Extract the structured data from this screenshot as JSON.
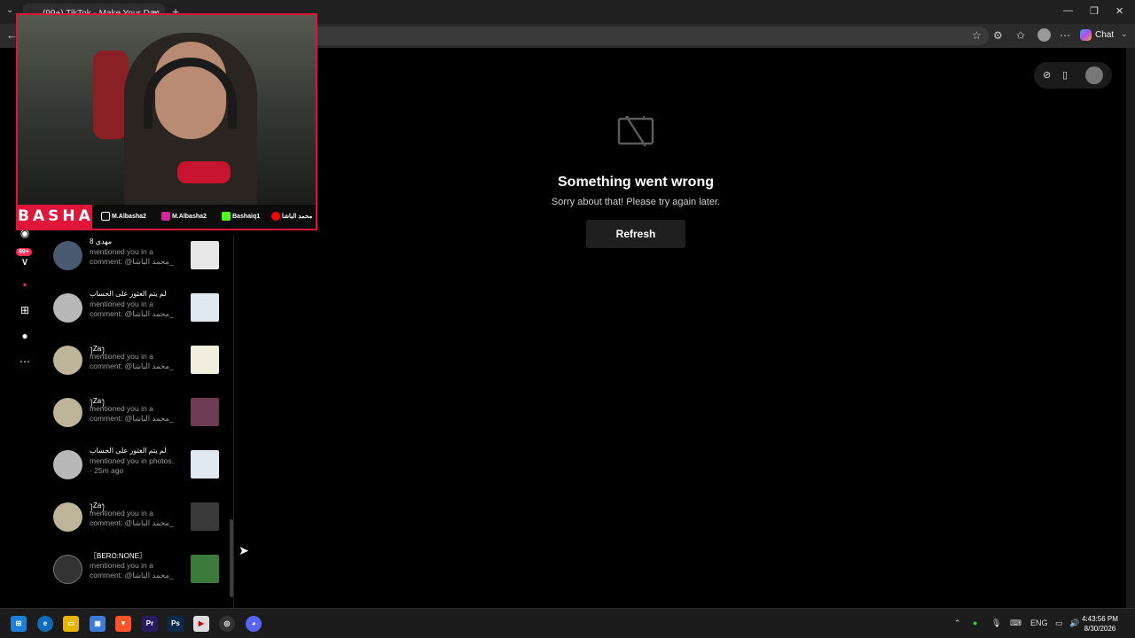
{
  "browser": {
    "tab_title": "(99+) TikTok - Make Your Day",
    "chat_label": "Chat"
  },
  "error": {
    "title": "Something went wrong",
    "subtitle": "Sorry about that! Please try again later.",
    "refresh_label": "Refresh"
  },
  "sidebar": {
    "badge": "99+"
  },
  "notifications": [
    {
      "name": "مهدي 8",
      "text": "mentioned you in a comment: @محمد الباشا_"
    },
    {
      "name": "لم يتم العثور على الحساب",
      "text": "mentioned you in a comment: @محمد الباشا_"
    },
    {
      "name": "ꫂZaꫂ",
      "text": "mentioned you in a comment: @محمد الباشا_"
    },
    {
      "name": "ꫂZaꫂ",
      "text": "mentioned you in a comment: @محمد الباشا_"
    },
    {
      "name": "لم يتم العثور على الحساب",
      "text": "mentioned you in photos. · 25m ago"
    },
    {
      "name": "ꫂZaꫂ",
      "text": "mentioned you in a comment: @محمد الباشا_"
    },
    {
      "name": "〖BERO:NONE〗",
      "text": "mentioned you in a comment: @محمد الباشا_"
    }
  ],
  "webcam": {
    "brand": "BASHA",
    "socials": [
      "M.Albasha2",
      "M.Albasha2",
      "Bashaiq1",
      "محمد الباشا"
    ]
  },
  "taskbar": {
    "lang": "ENG",
    "time": "4:43:56 PM",
    "date": "8/30/2026"
  },
  "colors": {
    "accent": "#fe2c55",
    "webcam_border": "#e0153a"
  }
}
